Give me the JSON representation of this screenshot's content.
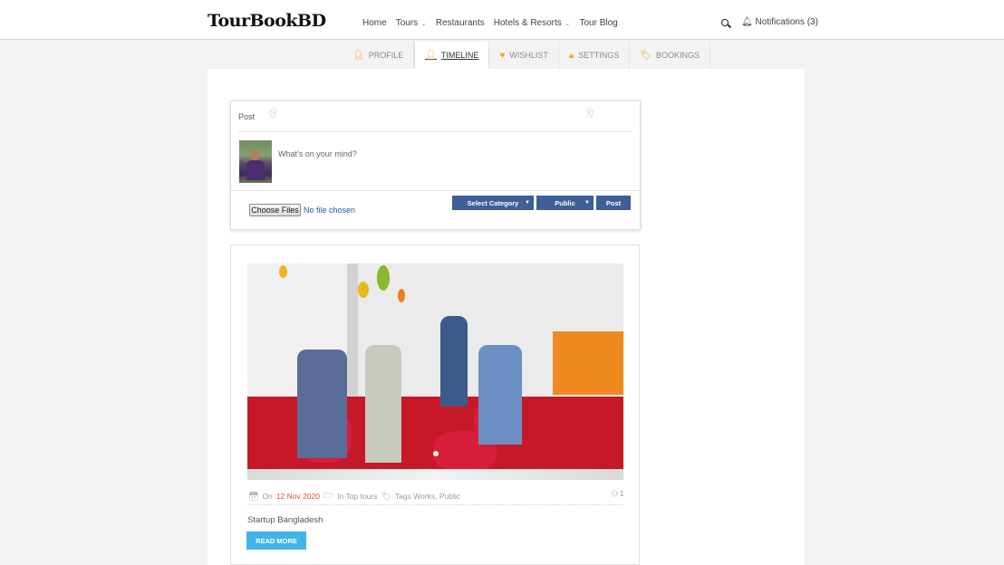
{
  "header": {
    "logo": "TourBookBD",
    "nav": [
      {
        "label": "Home",
        "caret": false
      },
      {
        "label": "Tours",
        "caret": true
      },
      {
        "label": "Restaurants",
        "caret": false
      },
      {
        "label": "Hotels & Resorts",
        "caret": true
      },
      {
        "label": "Tour Blog",
        "caret": false
      }
    ],
    "notifications": "Notifications (3)"
  },
  "tabs": [
    {
      "label": "PROFILE",
      "icon": "user-icon",
      "active": false
    },
    {
      "label": "TIMELINE",
      "icon": "user-icon",
      "active": true
    },
    {
      "label": "WISHLIST",
      "icon": "heart-icon",
      "active": false
    },
    {
      "label": "SETTINGS",
      "icon": "lock-icon",
      "active": false
    },
    {
      "label": "BOOKINGS",
      "icon": "tag-icon",
      "active": false
    }
  ],
  "composer": {
    "title": "Post",
    "placeholder": "What's on your mind?",
    "choose_files": "Choose Files",
    "file_status": "No file chosen",
    "category_label": "Select Category",
    "privacy_label": "Public",
    "post_label": "Post"
  },
  "post": {
    "date_prefix": "On",
    "date": "12 Nov 2020",
    "category_text": "In Top tours",
    "tags_text": "Tags Works, Public",
    "comment_count": "1",
    "title": "Startup Bangladesh",
    "read_more": "READ MORE"
  },
  "colors": {
    "accent_orange": "#f0a31a",
    "button_blue": "#3e5f98",
    "read_more_blue": "#41b6e6",
    "date_red": "#e0493b"
  }
}
